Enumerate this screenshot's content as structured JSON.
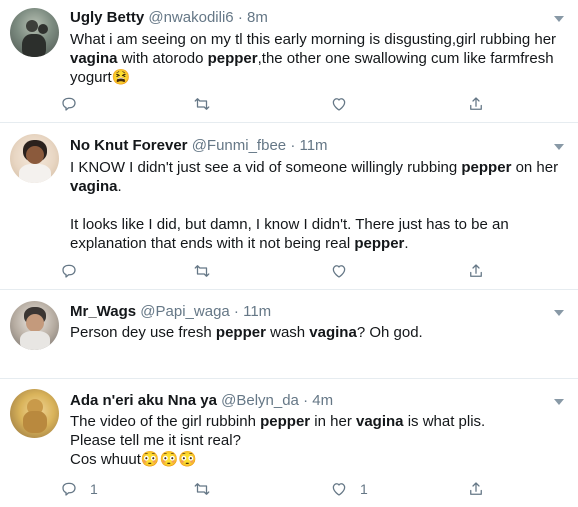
{
  "colors": {
    "accent": "#1da1f2",
    "text": "#14171a",
    "muted": "#657786",
    "divider": "#e6ecf0"
  },
  "tweets": [
    {
      "name": "Ugly Betty",
      "handle": "@nwakodili6",
      "dot": "·",
      "time": "8m",
      "text_parts": [
        {
          "t": "What i am seeing on my tl this early morning is disgusting,girl rubbing her ",
          "b": false
        },
        {
          "t": "vagina",
          "b": true
        },
        {
          "t": " with atorodo ",
          "b": false
        },
        {
          "t": "pepper",
          "b": true
        },
        {
          "t": ",the other one swallowing cum like farmfresh yogurt",
          "b": false
        },
        {
          "t": "😫",
          "b": false
        }
      ],
      "reply_count": "",
      "like_count": ""
    },
    {
      "name": "No Knut Forever",
      "handle": "@Funmi_fbee",
      "dot": "·",
      "time": "11m",
      "text_parts": [
        {
          "t": "I KNOW I didn't just see a vid of someone willingly rubbing ",
          "b": false
        },
        {
          "t": "pepper",
          "b": true
        },
        {
          "t": " on her ",
          "b": false
        },
        {
          "t": "vagina",
          "b": true
        },
        {
          "t": ".\n\nIt looks like I did, but damn, I know I didn't. There just has to be an explanation that ends with it not being real ",
          "b": false
        },
        {
          "t": "pepper",
          "b": true
        },
        {
          "t": ".",
          "b": false
        }
      ],
      "reply_count": "",
      "like_count": ""
    },
    {
      "name": "Mr_Wags",
      "handle": "@Papi_waga",
      "dot": "·",
      "time": "11m",
      "text_parts": [
        {
          "t": "Person dey use fresh ",
          "b": false
        },
        {
          "t": "pepper",
          "b": true
        },
        {
          "t": " wash ",
          "b": false
        },
        {
          "t": "vagina",
          "b": true
        },
        {
          "t": "? Oh god.",
          "b": false
        }
      ],
      "reply_count": "",
      "like_count": ""
    },
    {
      "name": "Ada n'eri aku Nna ya",
      "handle": "@Belyn_da",
      "dot": "·",
      "time": "4m",
      "text_parts": [
        {
          "t": "The video of the girl rubbinh ",
          "b": false
        },
        {
          "t": "pepper",
          "b": true
        },
        {
          "t": " in her ",
          "b": false
        },
        {
          "t": "vagina",
          "b": true
        },
        {
          "t": " is what plis.\nPlease tell me it isnt real?\nCos whuut",
          "b": false
        },
        {
          "t": "😳😳😳",
          "b": false
        }
      ],
      "reply_count": "1",
      "like_count": "1"
    }
  ],
  "icons": {
    "reply": "reply-icon",
    "retweet": "retweet-icon",
    "like": "like-icon",
    "share": "share-icon",
    "caret": "chevron-down-icon"
  }
}
